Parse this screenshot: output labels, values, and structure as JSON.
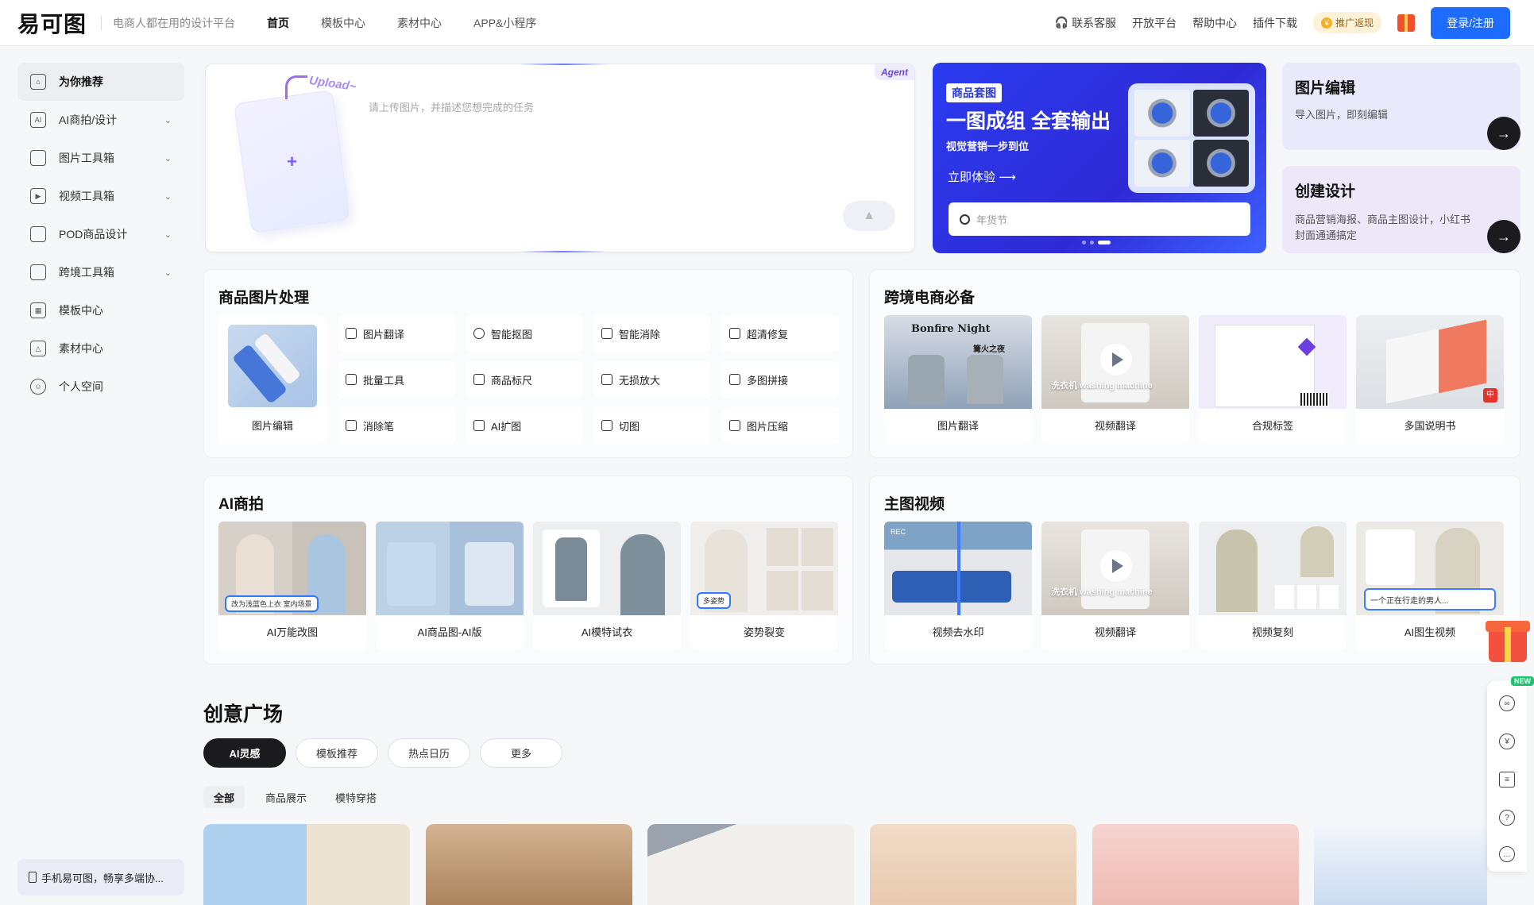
{
  "header": {
    "logo": "易可图",
    "slogan": "电商人都在用的设计平台",
    "nav": [
      "首页",
      "模板中心",
      "素材中心",
      "APP&小程序"
    ],
    "right_links": [
      "联系客服",
      "开放平台",
      "帮助中心",
      "插件下载"
    ],
    "promo": "推广返现",
    "login": "登录/注册"
  },
  "sidebar": {
    "items": [
      {
        "label": "为你推荐",
        "icon": "home-icon"
      },
      {
        "label": "AI商拍/设计",
        "icon": "ai-icon"
      },
      {
        "label": "图片工具箱",
        "icon": "toolbox-icon"
      },
      {
        "label": "视频工具箱",
        "icon": "video-icon"
      },
      {
        "label": "POD商品设计",
        "icon": "bag-icon"
      },
      {
        "label": "跨境工具箱",
        "icon": "crossborder-icon"
      },
      {
        "label": "模板中心",
        "icon": "template-icon"
      },
      {
        "label": "素材中心",
        "icon": "material-icon"
      },
      {
        "label": "个人空间",
        "icon": "user-icon"
      }
    ],
    "bottom": "手机易可图，畅享多端协..."
  },
  "upload": {
    "agent": "Agent",
    "word": "Upload~",
    "placeholder": "请上传图片，并描述您想完成的任务"
  },
  "banner": {
    "tag": "商品套图",
    "title": "一图成组 全套输出",
    "subtitle": "视觉营销一步到位",
    "cta": "立即体验",
    "search_placeholder": "年货节"
  },
  "mini_cards": [
    {
      "title": "图片编辑",
      "desc": "导入图片，即刻编辑"
    },
    {
      "title": "创建设计",
      "desc": "商品营销海报、商品主图设计，小红书封面通通搞定"
    }
  ],
  "product_processing": {
    "title": "商品图片处理",
    "big": "图片编辑",
    "tools": [
      "图片翻译",
      "智能抠图",
      "智能消除",
      "超清修复",
      "批量工具",
      "商品标尺",
      "无损放大",
      "多图拼接",
      "消除笔",
      "AI扩图",
      "切图",
      "图片压缩"
    ]
  },
  "crossborder": {
    "title": "跨境电商必备",
    "cards": [
      "图片翻译",
      "视频翻译",
      "合规标签",
      "多国说明书"
    ],
    "bonfire": "Bonfire Night",
    "bonfire_cn": "篝火之夜",
    "washing": "洗衣机 washing machine"
  },
  "ai_shoot": {
    "title": "AI商拍",
    "cards": [
      "AI万能改图",
      "AI商品图-AI版",
      "AI模特试衣",
      "姿势裂变"
    ],
    "chip1": "改为浅蓝色上衣 室内场景",
    "chip4": "多姿势"
  },
  "main_video": {
    "title": "主图视频",
    "cards": [
      "视频去水印",
      "视频翻译",
      "视频复刻",
      "AI图生视频"
    ],
    "rec": "REC",
    "prompt": "一个正在行走的男人..."
  },
  "plaza": {
    "title": "创意广场",
    "pills": [
      "AI灵感",
      "模板推荐",
      "热点日历",
      "更多"
    ],
    "subtabs": [
      "全部",
      "商品展示",
      "模特穿搭"
    ]
  },
  "rail": {
    "new": "NEW"
  },
  "colors": {
    "accent": "#1e6bff",
    "banner": "#2f2ad6",
    "dark": "#1b1b1f"
  }
}
